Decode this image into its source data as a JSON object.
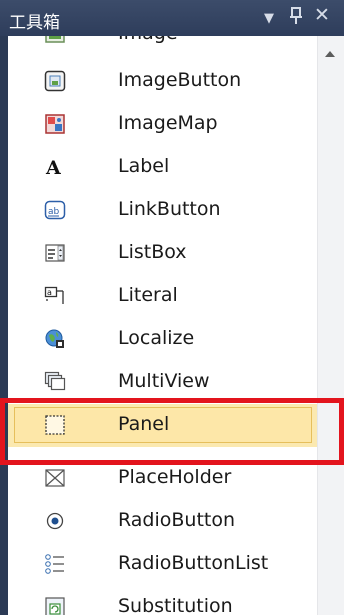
{
  "titlebar": {
    "title": "工具箱",
    "dropdown_icon": "▼",
    "pin_icon": "ᅟ",
    "close_icon": "✕"
  },
  "toolbox": {
    "items": [
      {
        "label": "Image",
        "icon": "image-icon"
      },
      {
        "label": "ImageButton",
        "icon": "image-button-icon"
      },
      {
        "label": "ImageMap",
        "icon": "image-map-icon"
      },
      {
        "label": "Label",
        "icon": "label-icon"
      },
      {
        "label": "LinkButton",
        "icon": "link-button-icon"
      },
      {
        "label": "ListBox",
        "icon": "list-box-icon"
      },
      {
        "label": "Literal",
        "icon": "literal-icon"
      },
      {
        "label": "Localize",
        "icon": "localize-icon"
      },
      {
        "label": "MultiView",
        "icon": "multiview-icon"
      },
      {
        "label": "Panel",
        "icon": "panel-icon",
        "selected": true
      },
      {
        "label": "PlaceHolder",
        "icon": "placeholder-icon"
      },
      {
        "label": "RadioButton",
        "icon": "radio-button-icon"
      },
      {
        "label": "RadioButtonList",
        "icon": "radio-button-list-icon"
      },
      {
        "label": "Substitution",
        "icon": "substitution-icon"
      }
    ]
  },
  "colors": {
    "highlight_border": "#e3141d",
    "selected_fill": "#fde7a8"
  }
}
